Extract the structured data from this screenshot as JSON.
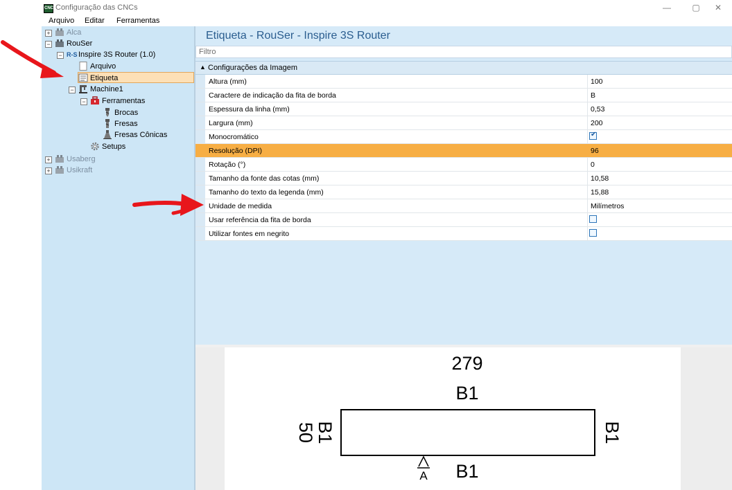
{
  "window": {
    "title": "Configuração das CNCs",
    "app_icon_text": "CNC",
    "controls": {
      "minimize": "—",
      "restore": "▢",
      "close": "✕"
    }
  },
  "menu": [
    "Arquivo",
    "Editar",
    "Ferramentas"
  ],
  "tree": [
    {
      "label": "Alca",
      "expander": "+",
      "icon": "machine-icon",
      "muted": true
    },
    {
      "label": "RouSer",
      "expander": "−",
      "icon": "machine-icon"
    },
    {
      "label": "Inspire 3S Router (1.0)",
      "expander": "−",
      "icon": "rs-logo-icon",
      "icon_text": "R-S"
    },
    {
      "label": "Arquivo",
      "icon": "file-icon"
    },
    {
      "label": "Etiqueta",
      "icon": "label-icon",
      "selected": true
    },
    {
      "label": "Machine1",
      "expander": "−",
      "icon": "machine-tool-icon"
    },
    {
      "label": "Ferramentas",
      "expander": "−",
      "icon": "toolbox-icon"
    },
    {
      "label": "Brocas",
      "icon": "drill-bit-icon"
    },
    {
      "label": "Fresas",
      "icon": "mill-cutter-icon"
    },
    {
      "label": "Fresas Cônicas",
      "icon": "conical-cutter-icon"
    },
    {
      "label": "Setups",
      "icon": "gear-icon"
    },
    {
      "label": "Usaberg",
      "expander": "+",
      "icon": "machine-icon",
      "muted": true
    },
    {
      "label": "Usikraft",
      "expander": "+",
      "icon": "machine-icon",
      "muted": true
    }
  ],
  "main": {
    "title": "Etiqueta - RouSer - Inspire 3S Router",
    "filter_placeholder": "Filtro",
    "category": "Configurações da Imagem",
    "properties": [
      {
        "name": "Altura (mm)",
        "value": "100"
      },
      {
        "name": "Caractere de indicação da fita de borda",
        "value": "B"
      },
      {
        "name": "Espessura da linha (mm)",
        "value": "0,53"
      },
      {
        "name": "Largura (mm)",
        "value": "200"
      },
      {
        "name": "Monocromático",
        "checkbox": true,
        "checked": true
      },
      {
        "name": "Resolução (DPI)",
        "value": "96",
        "highlighted": true
      },
      {
        "name": "Rotação (°)",
        "value": "0"
      },
      {
        "name": "Tamanho da fonte das cotas (mm)",
        "value": "10,58"
      },
      {
        "name": "Tamanho do texto da legenda (mm)",
        "value": "15,88"
      },
      {
        "name": "Unidade de medida",
        "value": "Milímetros"
      },
      {
        "name": "Usar referência da fita de borda",
        "checkbox": true,
        "checked": false
      },
      {
        "name": "Utilizar fontes em negrito",
        "checkbox": true,
        "checked": false
      }
    ]
  },
  "preview": {
    "width_label": "279",
    "height_label": "50",
    "edge_top": "B1",
    "edge_bottom": "B1",
    "edge_left": "B1",
    "edge_right": "B1",
    "grain_letter": "A"
  },
  "colors": {
    "sidebar_bg": "#cde6f6",
    "panel_bg": "#d6eaf8",
    "highlight": "#f7ae44",
    "title_blue": "#2a5d8f",
    "annotation_arrow": "#e8161b"
  }
}
